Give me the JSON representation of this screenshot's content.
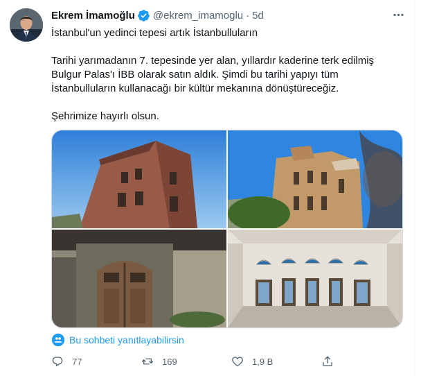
{
  "user": {
    "name": "Ekrem İmamoğlu",
    "handle": "@ekrem_imamoglu",
    "separator": "·",
    "time": "5d"
  },
  "tweet": {
    "line1": "İstanbul'un yedinci tepesi artık İstanbulluların",
    "para2": "Tarihi yarımadanın 7. tepesinde yer alan, yıllardır kaderine terk edilmiş Bulgur Palas'ı İBB olarak satın aldık. Şimdi bu tarihi yapıyı tüm İstanbulluların kullanacağı bir kültür mekanına dönüştüreceğiz.",
    "para3": "Şehrimize hayırlı olsun."
  },
  "reply_note": "Bu sohbeti yanıtlayabilirsin",
  "stats": {
    "replies": "77",
    "retweets": "169",
    "likes": "1,9 B"
  },
  "icons": {
    "verified": "verified-badge-icon",
    "more": "more-icon",
    "reply": "reply-icon",
    "retweet": "retweet-icon",
    "like": "heart-icon",
    "share": "share-icon",
    "conversation": "people-icon"
  },
  "colors": {
    "accent": "#1d9bf0",
    "secondary_text": "#536471",
    "primary_text": "#0f1419"
  }
}
